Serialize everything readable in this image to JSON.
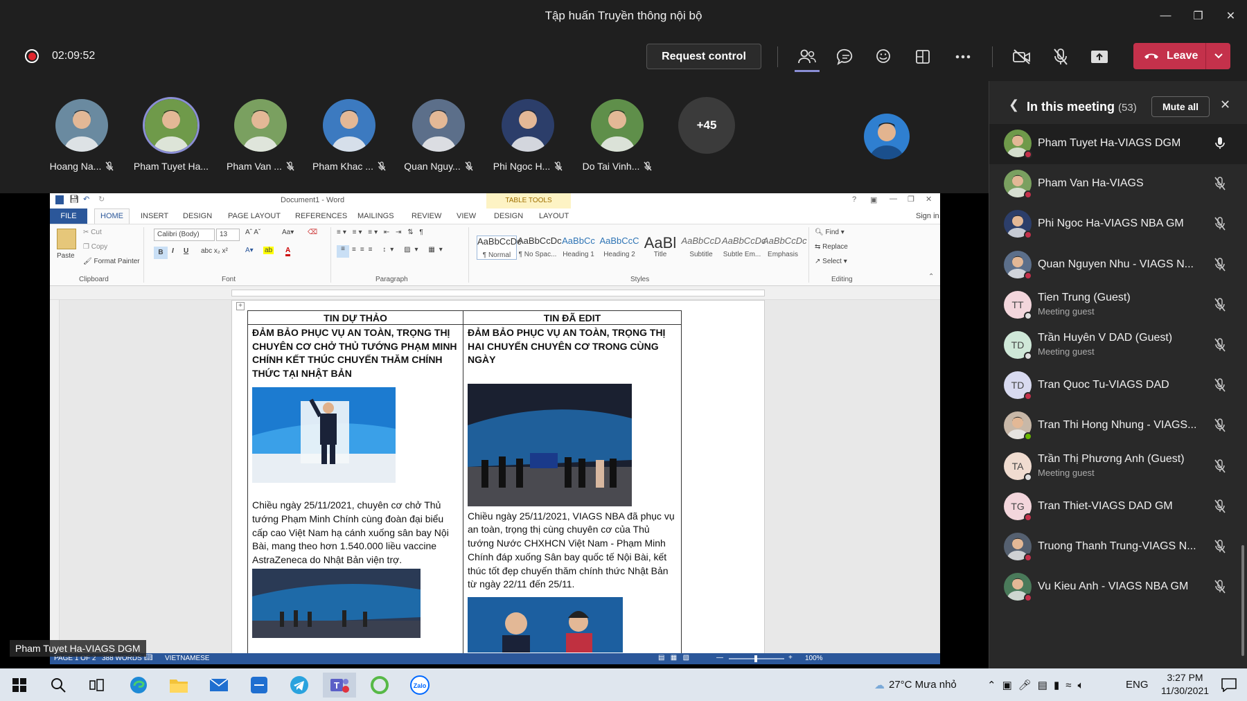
{
  "window": {
    "title": "Tập huấn Truyền thông nội bộ"
  },
  "meeting": {
    "timer": "02:09:52",
    "request_control": "Request control",
    "leave": "Leave"
  },
  "participants_strip": [
    {
      "name": "Hoang Na...",
      "color": "#6a8aa0"
    },
    {
      "name": "Pham Tuyet Ha...",
      "color": "#6f9a4a"
    },
    {
      "name": "Pham Van ...",
      "color": "#7aa060"
    },
    {
      "name": "Pham Khac ...",
      "color": "#3c7ac0"
    },
    {
      "name": "Quan Nguy...",
      "color": "#5c6f8a"
    },
    {
      "name": "Phi Ngoc H...",
      "color": "#2c3e6a"
    },
    {
      "name": "Do Tai Vinh...",
      "color": "#5f8f4a"
    }
  ],
  "more_count": "+45",
  "panel": {
    "title": "In this meeting",
    "count": "(53)",
    "mute_all": "Mute all",
    "people": [
      {
        "name": "Pham Tuyet Ha-VIAGS DGM",
        "sub": "",
        "init": "",
        "bg": "#6f9a4a",
        "status": "#c4314b",
        "mic": "on"
      },
      {
        "name": "Pham Van Ha-VIAGS",
        "sub": "",
        "init": "",
        "bg": "#7aa060",
        "status": "#c4314b",
        "mic": "off"
      },
      {
        "name": "Phi Ngoc Ha-VIAGS NBA GM",
        "sub": "",
        "init": "",
        "bg": "#2c3e6a",
        "status": "#c4314b",
        "mic": "off"
      },
      {
        "name": "Quan Nguyen Nhu - VIAGS N...",
        "sub": "",
        "init": "",
        "bg": "#5c6f8a",
        "status": "#c4314b",
        "mic": "off"
      },
      {
        "name": "Tien Trung (Guest)",
        "sub": "Meeting guest",
        "init": "TT",
        "bg": "#f3d6dc",
        "status": "#dddddd",
        "mic": "off"
      },
      {
        "name": "Trần Huyên V DAD (Guest)",
        "sub": "Meeting guest",
        "init": "TD",
        "bg": "#cfe8d8",
        "status": "#dddddd",
        "mic": "off"
      },
      {
        "name": "Tran Quoc Tu-VIAGS DAD",
        "sub": "",
        "init": "TD",
        "bg": "#d8daf0",
        "status": "#c4314b",
        "mic": "off"
      },
      {
        "name": "Tran Thi Hong Nhung - VIAGS...",
        "sub": "",
        "init": "",
        "bg": "#c8b8a8",
        "status": "#6bb700",
        "mic": "off"
      },
      {
        "name": "Trần Thị Phương Anh (Guest)",
        "sub": "Meeting guest",
        "init": "TA",
        "bg": "#f0dcd0",
        "status": "#dddddd",
        "mic": "off"
      },
      {
        "name": "Tran Thiet-VIAGS DAD GM",
        "sub": "",
        "init": "TG",
        "bg": "#f3d6dc",
        "status": "#c4314b",
        "mic": "off"
      },
      {
        "name": "Truong Thanh Trung-VIAGS N...",
        "sub": "",
        "init": "",
        "bg": "#556070",
        "status": "#c4314b",
        "mic": "off"
      },
      {
        "name": "Vu Kieu Anh - VIAGS NBA GM",
        "sub": "",
        "init": "",
        "bg": "#4a7a5a",
        "status": "#c4314b",
        "mic": "off"
      }
    ]
  },
  "word": {
    "doc_title": "Document1 - Word",
    "table_tools": "TABLE TOOLS",
    "sign_in": "Sign in",
    "tabs": [
      "FILE",
      "HOME",
      "INSERT",
      "DESIGN",
      "PAGE LAYOUT",
      "REFERENCES",
      "MAILINGS",
      "REVIEW",
      "VIEW",
      "DESIGN",
      "LAYOUT"
    ],
    "clipboard": {
      "paste": "Paste",
      "cut": "Cut",
      "copy": "Copy",
      "format_painter": "Format Painter",
      "label": "Clipboard"
    },
    "font": {
      "name": "Calibri (Body)",
      "size": "13",
      "label": "Font"
    },
    "paragraph_label": "Paragraph",
    "styles": [
      {
        "sample": "AaBbCcDc",
        "name": "¶ Normal"
      },
      {
        "sample": "AaBbCcDc",
        "name": "¶ No Spac..."
      },
      {
        "sample": "AaBbCc",
        "name": "Heading 1"
      },
      {
        "sample": "AaBbCcC",
        "name": "Heading 2"
      },
      {
        "sample": "AaBl",
        "name": "Title"
      },
      {
        "sample": "AaBbCcD",
        "name": "Subtitle"
      },
      {
        "sample": "AaBbCcDc",
        "name": "Subtle Em..."
      },
      {
        "sample": "AaBbCcDc",
        "name": "Emphasis"
      }
    ],
    "styles_label": "Styles",
    "editing": {
      "find": "Find",
      "replace": "Replace",
      "select": "Select",
      "label": "Editing"
    },
    "left_col": {
      "header": "TIN DỰ THẢO",
      "headline": "ĐẢM BẢO PHỤC VỤ AN TOÀN, TRỌNG THỊ CHUYÊN CƠ CHỞ THỦ TƯỚNG PHẠM MINH CHÍNH KẾT THÚC CHUYẾN THĂM CHÍNH THỨC TẠI NHẬT BẢN",
      "body": "Chiều ngày 25/11/2021, chuyên cơ chở Thủ tướng Phạm Minh Chính cùng đoàn đại biểu cấp cao Việt Nam hạ cánh xuống sân bay Nội Bài, mang theo hơn 1.540.000 liều vaccine AstraZeneca do Nhật Bản viện trợ."
    },
    "right_col": {
      "header": "TIN ĐÃ EDIT",
      "headline": "ĐẢM BẢO PHỤC VỤ AN TOÀN, TRỌNG THỊ HAI CHUYẾN CHUYÊN CƠ TRONG CÙNG NGÀY",
      "body": "Chiều ngày 25/11/2021, VIAGS NBA đã phục vụ an toàn, trọng thị cùng chuyên cơ của Thủ tướng Nước CHXHCN Việt Nam - Phạm Minh Chính đáp xuống Sân bay quốc tế Nội Bài, kết thúc tốt đẹp chuyến thăm chính thức Nhật Bản từ ngày 22/11 đến 25/11."
    },
    "status": {
      "page": "PAGE 1 OF 2",
      "words": "388 WORDS",
      "lang": "VIETNAMESE",
      "zoom": "100%"
    }
  },
  "presenter_tag": "Pham Tuyet Ha-VIAGS DGM",
  "taskbar": {
    "weather": "27°C  Mưa nhỏ",
    "lang": "ENG",
    "time": "3:27 PM",
    "date": "11/30/2021"
  }
}
